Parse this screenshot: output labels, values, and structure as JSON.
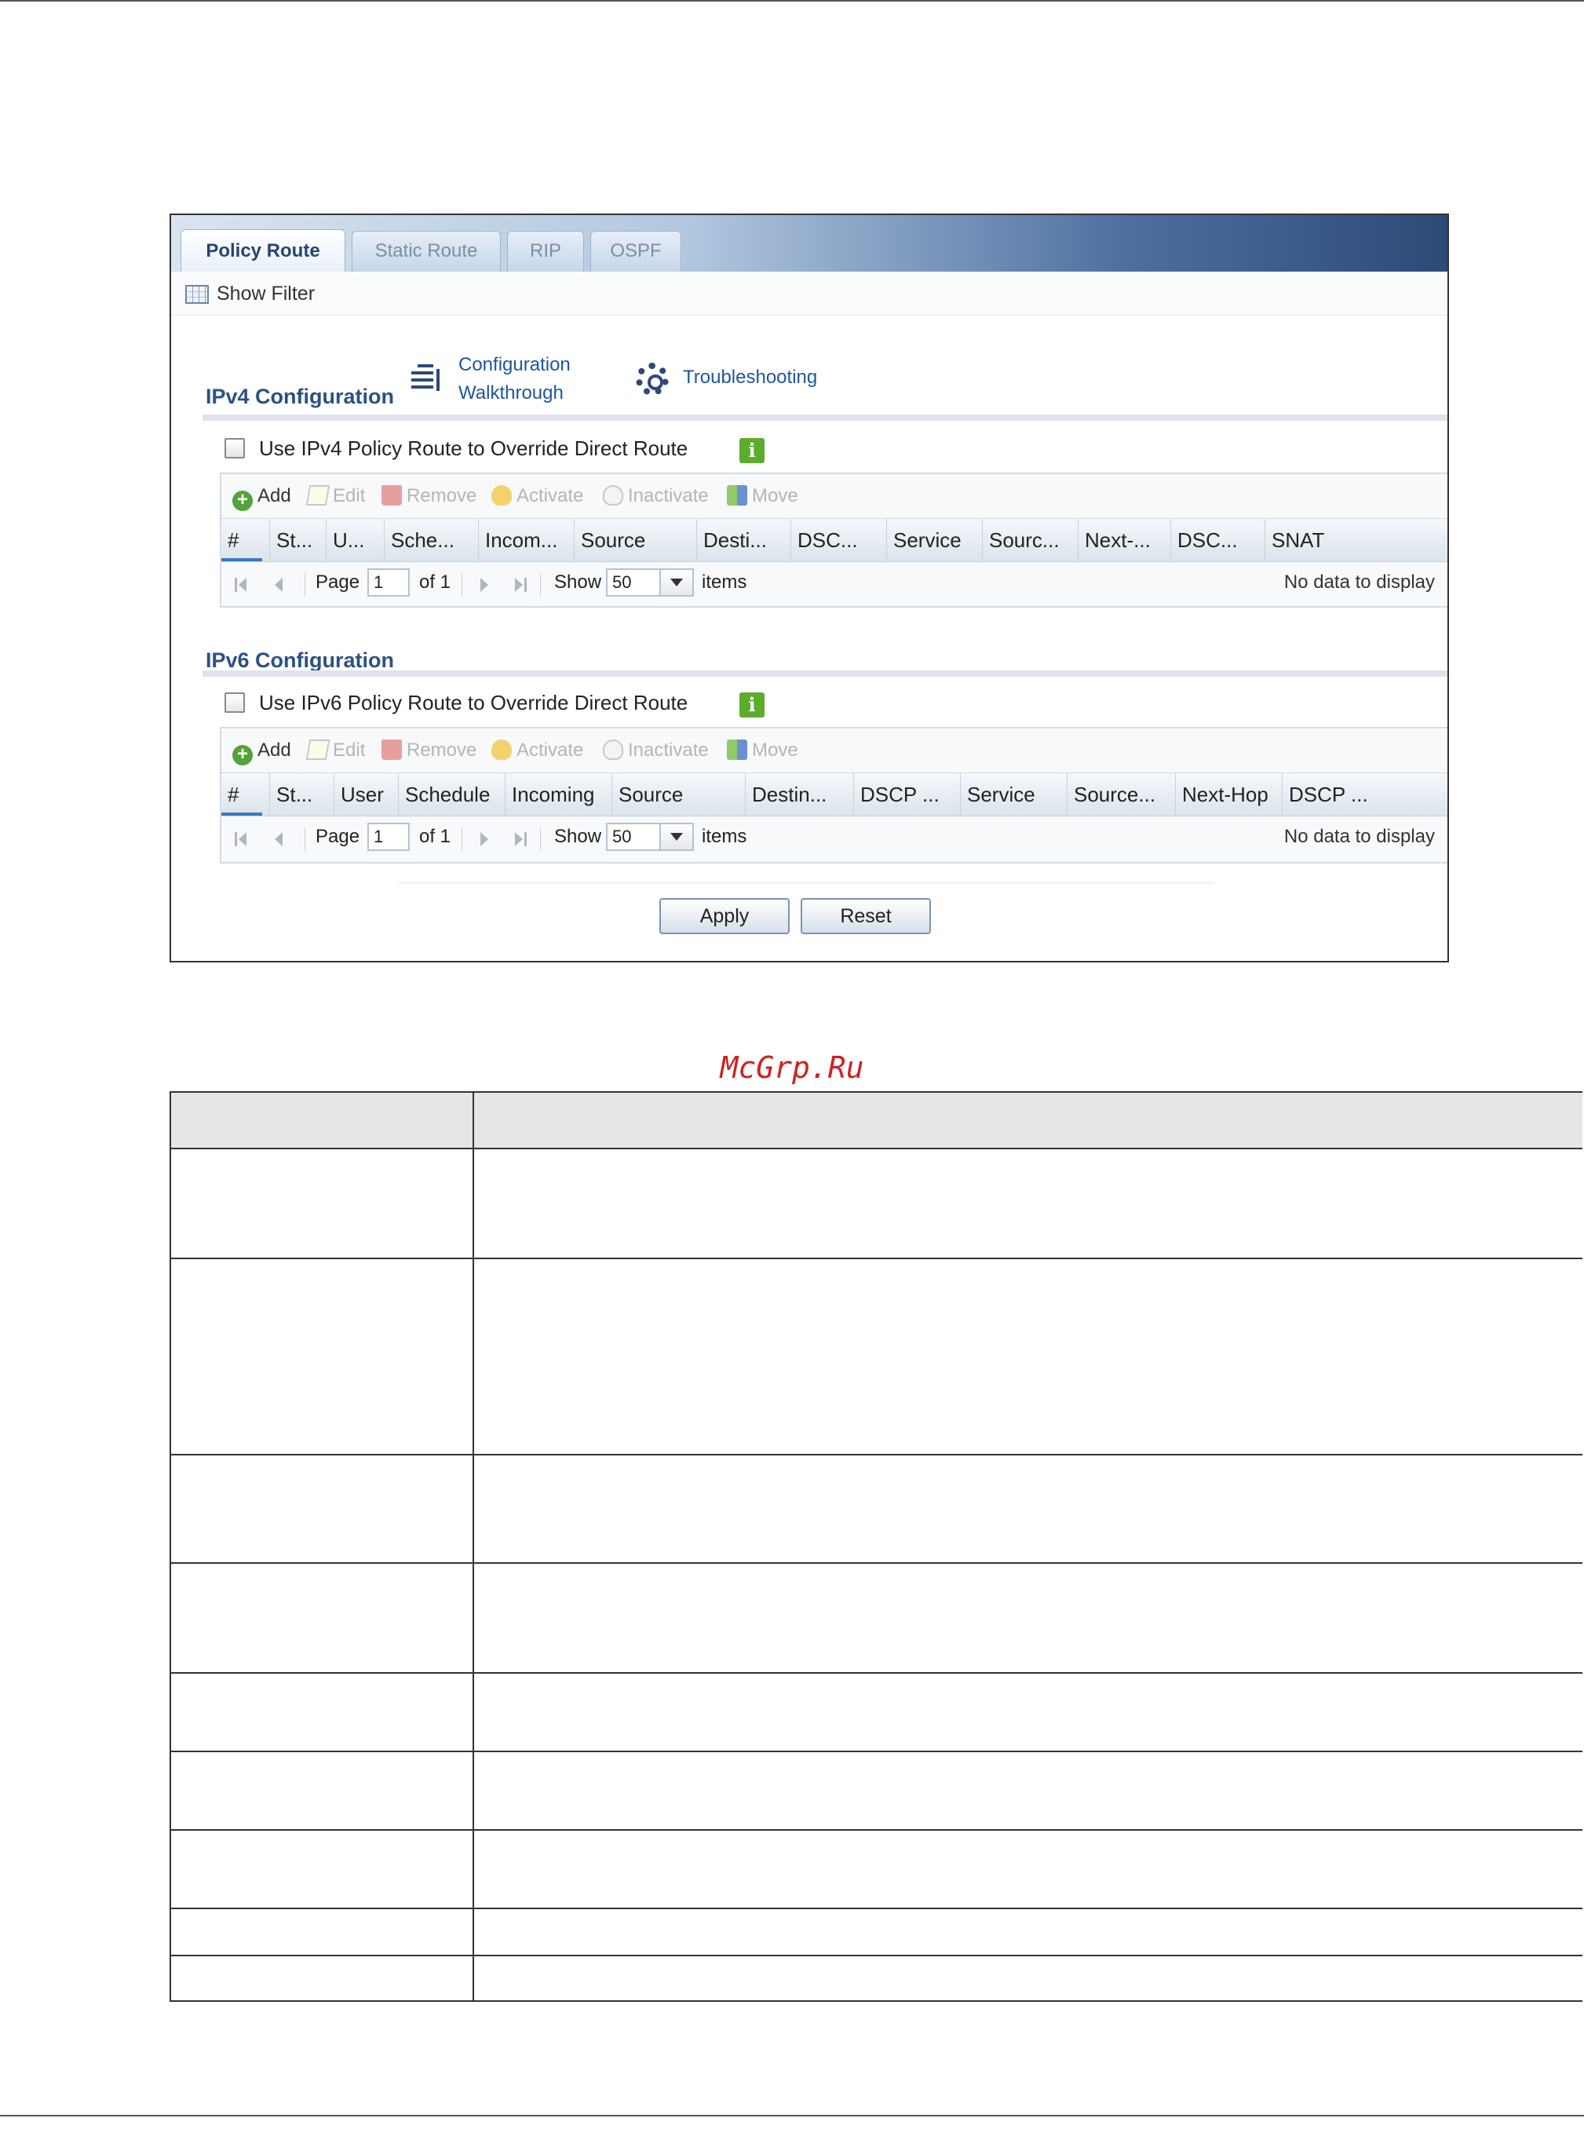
{
  "tabs": [
    {
      "label": "Policy Route",
      "active": true
    },
    {
      "label": "Static Route",
      "active": false
    },
    {
      "label": "RIP",
      "active": false
    },
    {
      "label": "OSPF",
      "active": false
    }
  ],
  "filter": {
    "label": "Show Filter",
    "icon": "filter-table-icon"
  },
  "ipv4": {
    "title": "IPv4 Configuration",
    "config_link": [
      "Configuration",
      "Walkthrough"
    ],
    "troubleshoot_link": "Troubleshooting",
    "override_label": "Use IPv4 Policy Route to Override Direct Route",
    "toolbar": [
      "Add",
      "Edit",
      "Remove",
      "Activate",
      "Inactivate",
      "Move"
    ],
    "columns": [
      "#",
      "St...",
      "U...",
      "Sche...",
      "Incom...",
      "Source",
      "Desti...",
      "DSC...",
      "Service",
      "Sourc...",
      "Next-...",
      "DSC...",
      "SNAT"
    ],
    "pager": {
      "page_label": "Page",
      "page_value": "1",
      "of_label": "of 1",
      "show_label": "Show",
      "show_value": "50",
      "items_label": "items",
      "nodata": "No data to display"
    }
  },
  "ipv6": {
    "title": "IPv6 Configuration",
    "override_label": "Use IPv6 Policy Route to Override Direct Route",
    "toolbar": [
      "Add",
      "Edit",
      "Remove",
      "Activate",
      "Inactivate",
      "Move"
    ],
    "columns": [
      "#",
      "St...",
      "User",
      "Schedule",
      "Incoming",
      "Source",
      "Destin...",
      "DSCP ...",
      "Service",
      "Source...",
      "Next-Hop",
      "DSCP ..."
    ],
    "pager": {
      "page_label": "Page",
      "page_value": "1",
      "of_label": "of 1",
      "show_label": "Show",
      "show_value": "50",
      "items_label": "items",
      "nodata": "No data to display"
    }
  },
  "buttons": {
    "apply": "Apply",
    "reset": "Reset"
  },
  "watermark": "McGrp.Ru",
  "colors": {
    "accent": "#2c5182",
    "tab_dark": "#2c4a78",
    "enabled_green": "#54a33a",
    "watermark": "#cc2222"
  }
}
